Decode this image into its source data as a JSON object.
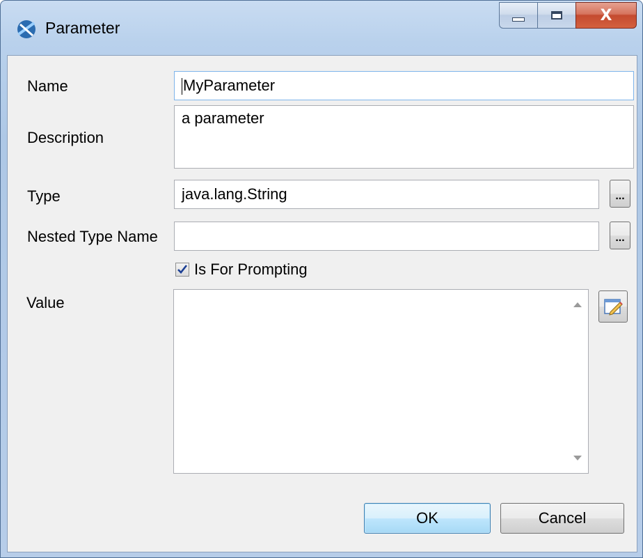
{
  "window": {
    "title": "Parameter",
    "close_glyph": "X",
    "icons": {
      "app": "app-logo-icon",
      "minimize": "minimize-icon",
      "maximize": "maximize-icon",
      "close": "close-icon"
    }
  },
  "form": {
    "name": {
      "label": "Name",
      "value": "MyParameter"
    },
    "description": {
      "label": "Description",
      "value": "a parameter"
    },
    "type": {
      "label": "Type",
      "value": "java.lang.String",
      "browse_label": "..."
    },
    "nested_type_name": {
      "label": "Nested Type Name",
      "value": "",
      "browse_label": "..."
    },
    "is_for_prompting": {
      "label": "Is For Prompting",
      "checked": true
    },
    "value": {
      "label": "Value",
      "value": ""
    }
  },
  "buttons": {
    "ok": "OK",
    "cancel": "Cancel"
  },
  "colors": {
    "title_gradient": "#b9d1ec",
    "close_button": "#c44a2f",
    "client_bg": "#f0f0f0",
    "focus_border": "#7eb4ea"
  }
}
